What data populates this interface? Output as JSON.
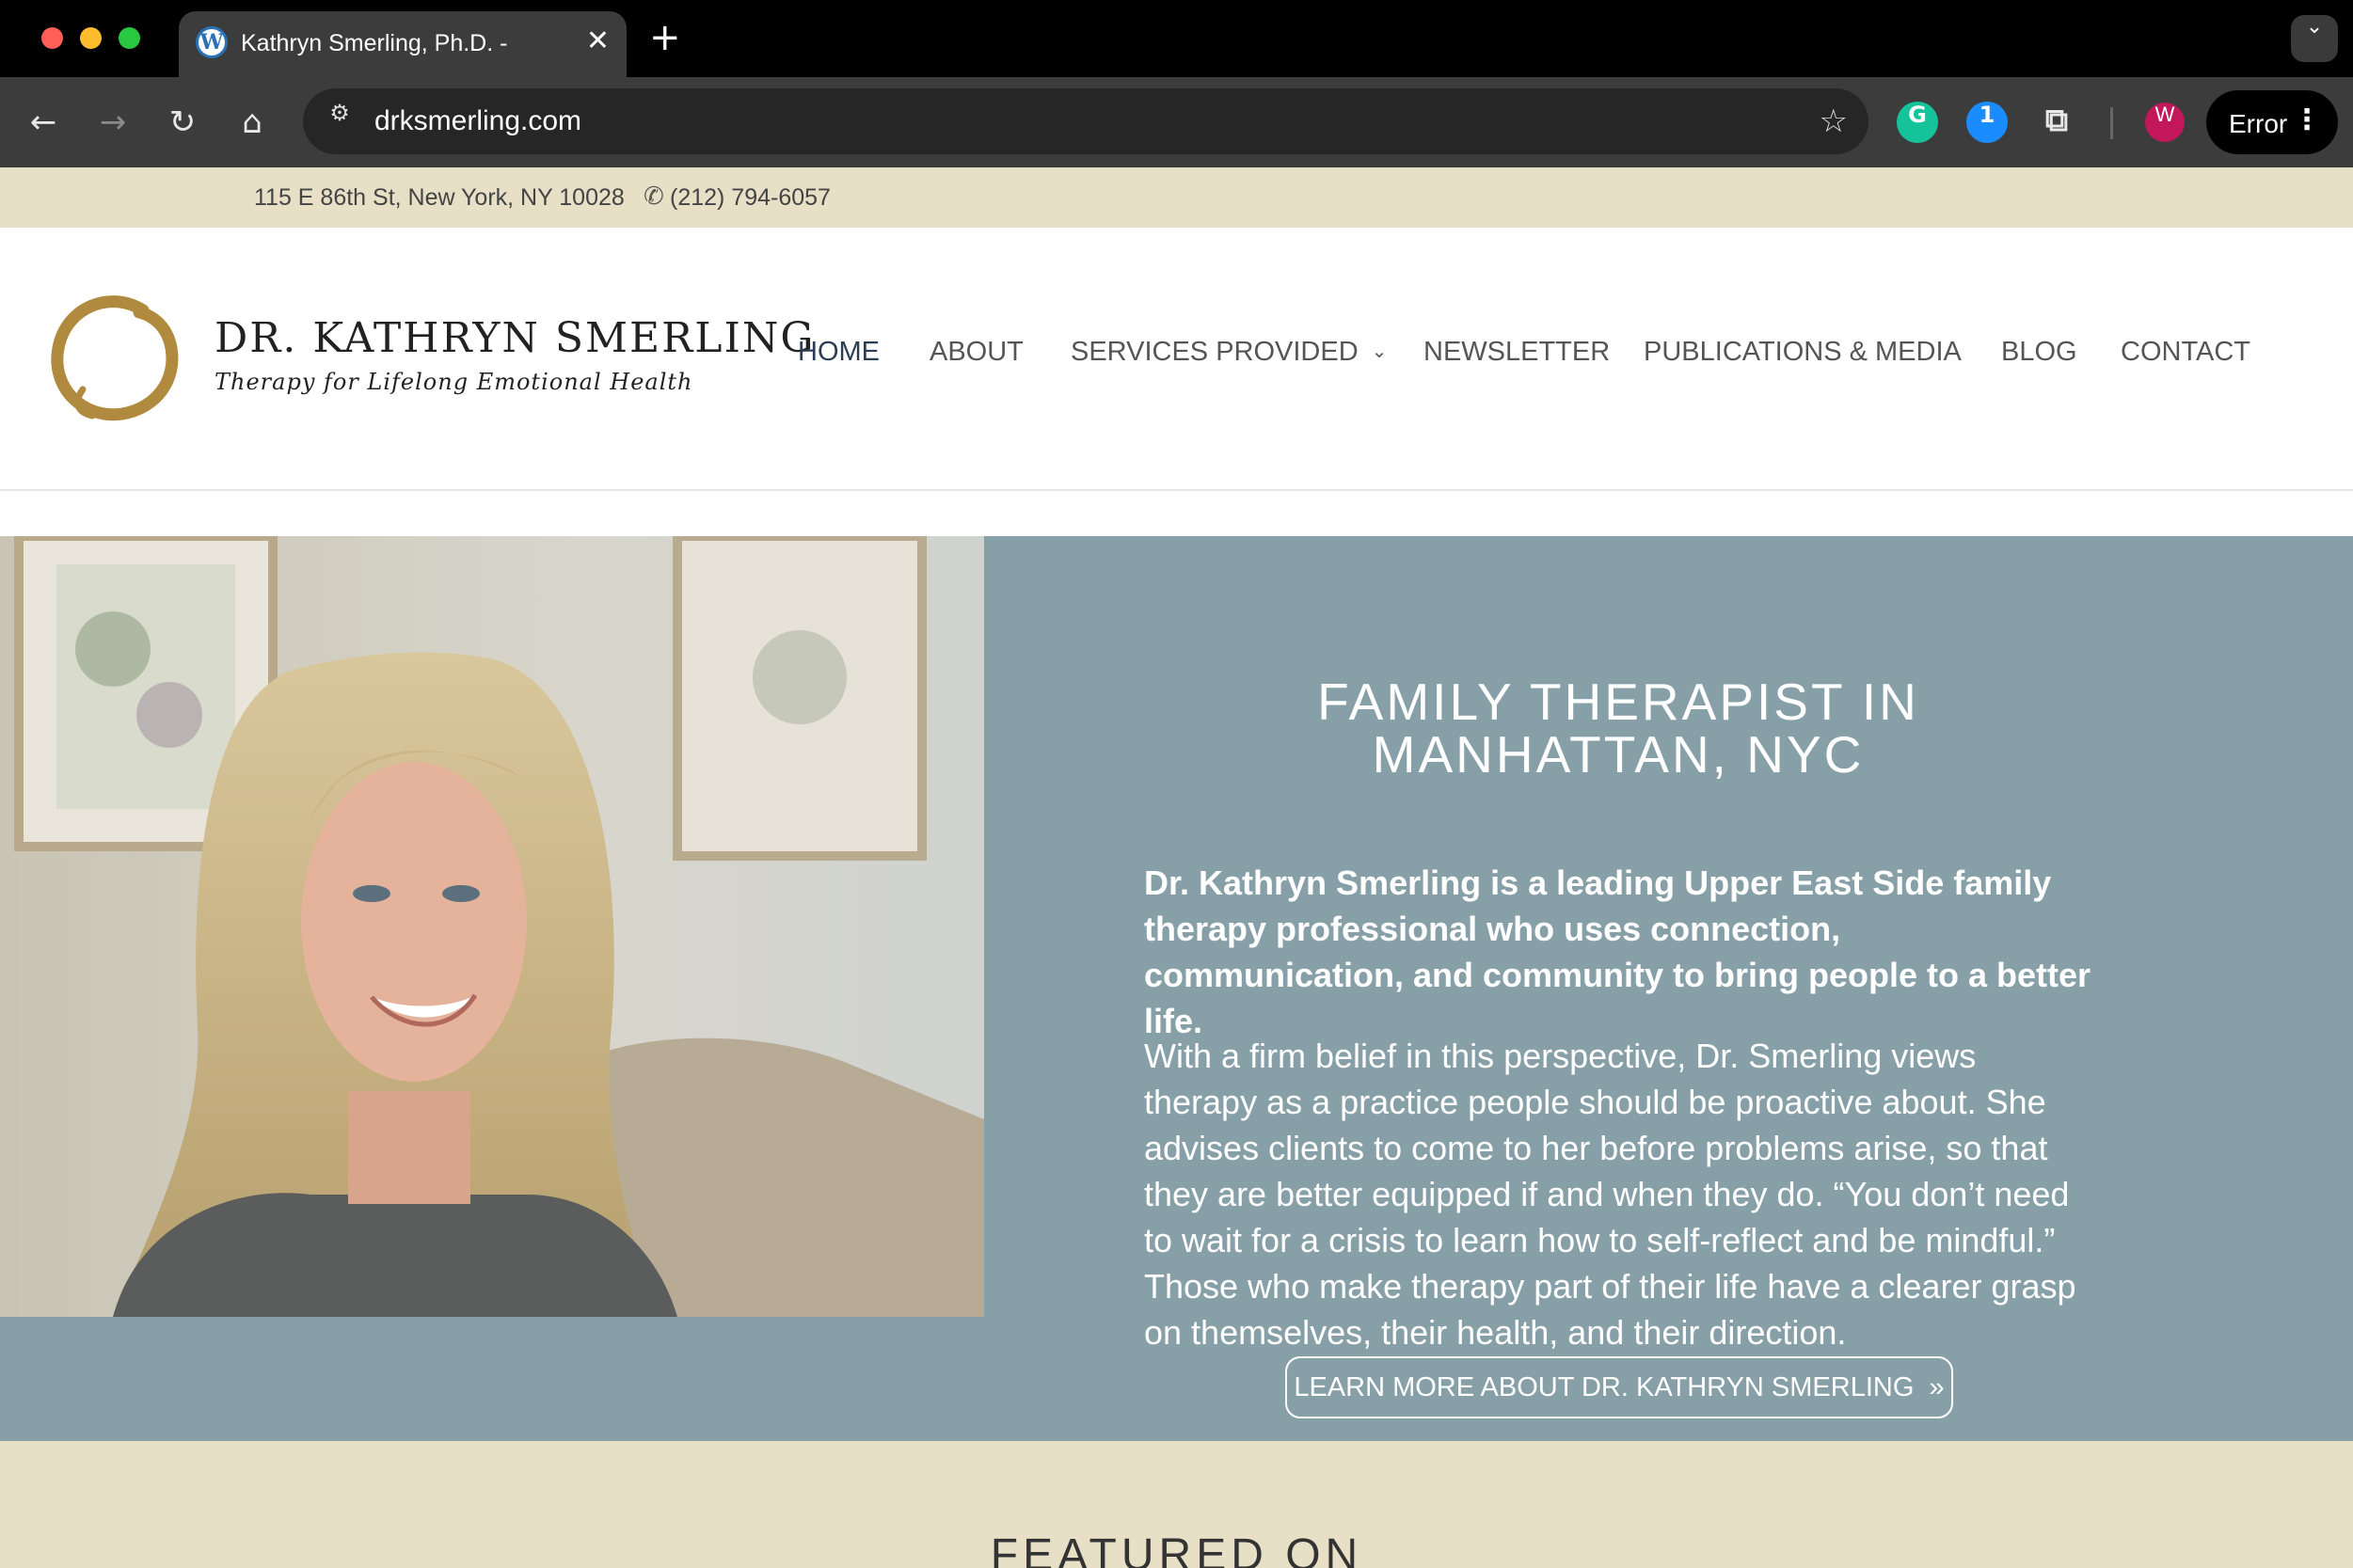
{
  "browser": {
    "tab_title": "Kathryn Smerling, Ph.D. -",
    "tab_favicon": "W",
    "tab_close": "✕",
    "new_tab": "+",
    "tab_menu_icon": "chevron-down-icon",
    "url": "drksmerling.com",
    "profile_initial": "W",
    "status_label": "Error",
    "icons": {
      "back": "arrow-left-icon",
      "forward": "arrow-right-icon",
      "reload": "reload-icon",
      "home": "home-icon",
      "site_info": "tune-icon",
      "bookmark": "star-icon",
      "extensions": [
        "grammarly-icon",
        "onepassword-icon",
        "puzzle-icon"
      ],
      "menu": "more-vertical-icon"
    }
  },
  "topbar": {
    "address": "115 E 86th St, New York, NY 10028",
    "phone": "(212) 794-6057"
  },
  "header": {
    "logo_name": "DR. KATHRYN SMERLING",
    "logo_tagline": "Therapy for Lifelong Emotional Health",
    "nav": [
      {
        "label": "HOME",
        "active": true
      },
      {
        "label": "ABOUT"
      },
      {
        "label": "SERVICES PROVIDED",
        "has_dropdown": true
      },
      {
        "label": "NEWSLETTER"
      },
      {
        "label": "PUBLICATIONS & MEDIA"
      },
      {
        "label": "BLOG"
      },
      {
        "label": "CONTACT"
      }
    ]
  },
  "hero": {
    "title_line1": "FAMILY THERAPIST IN",
    "title_line2": "MANHATTAN, NYC",
    "lead": "Dr. Kathryn Smerling is a leading Upper East Side family therapy professional who uses connection, communication, and community to bring people to a better life.",
    "body": "With a firm belief in this perspective, Dr. Smerling views therapy as a practice people should be proactive about. She advises clients to come to her before problems arise, so that they are better equipped if and when they do. “You don’t need to wait for a crisis to learn how to self-reflect and be mindful.” Those who make therapy part of their life have a clearer grasp on themselves, their health, and their direction.",
    "button_label": "LEARN MORE ABOUT DR. KATHRYN SMERLING",
    "button_arrow": "»"
  },
  "featured": {
    "title": "FEATURED ON"
  },
  "colors": {
    "chrome_dark": "#000000",
    "toolbar": "#3c3c3c",
    "topbar_beige": "#e7dfc6",
    "hero_slate": "#87a0a8",
    "logo_gold": "#b08a3e",
    "nav_active": "#2b3d55"
  }
}
